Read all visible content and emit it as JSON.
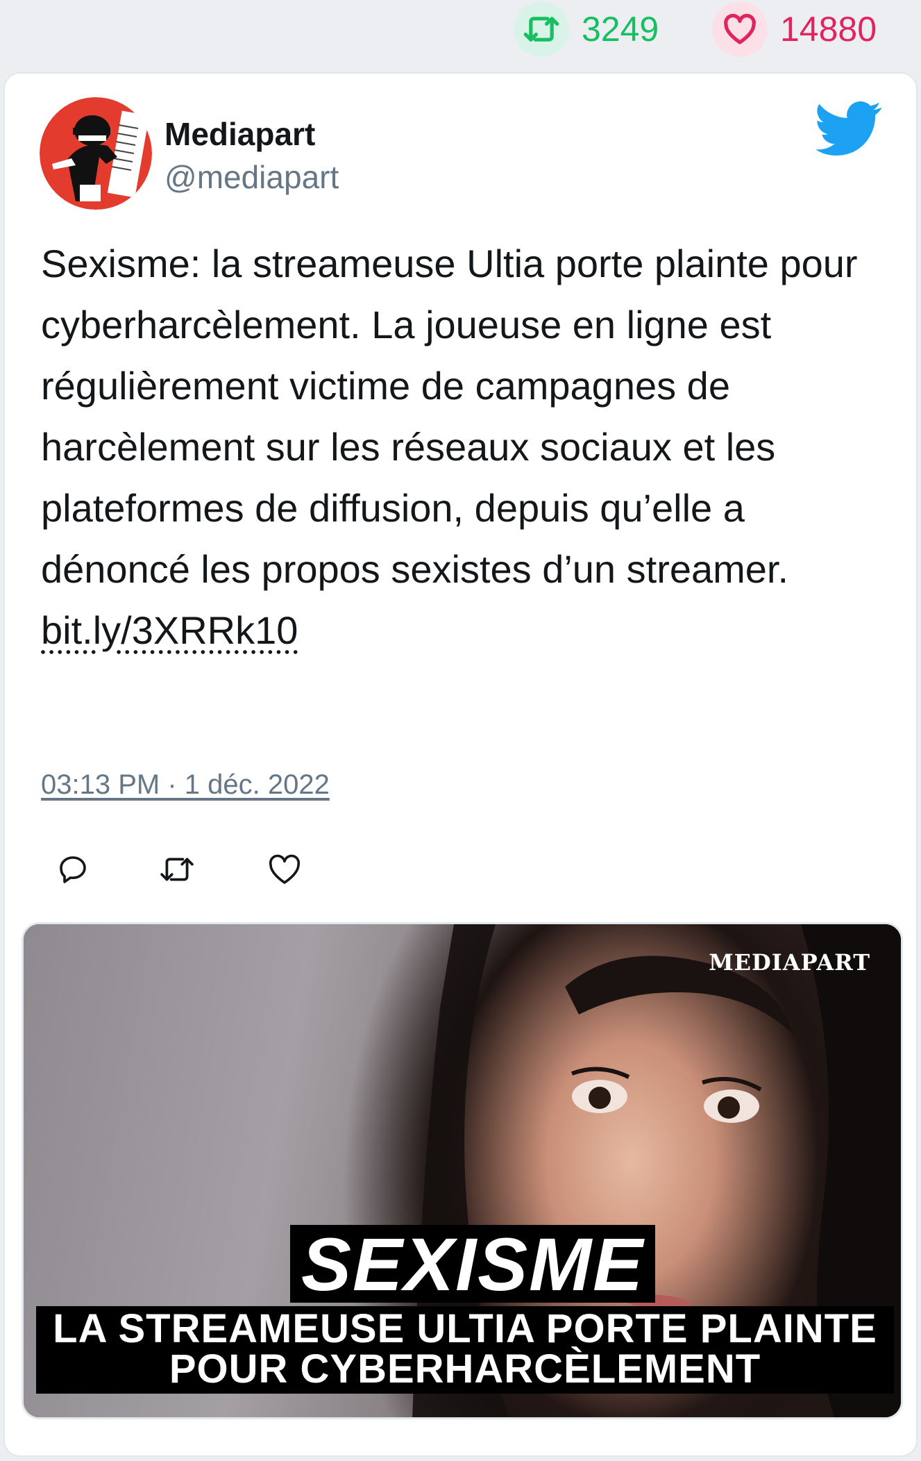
{
  "stats": {
    "retweets": "3249",
    "likes": "14880",
    "retweet_icon": "retweet-icon",
    "like_icon": "heart-icon"
  },
  "tweet": {
    "author_name": "Mediapart",
    "author_handle": "@mediapart",
    "text": "Sexisme: la streameuse Ultia porte plainte pour cyberharcèlement. La joueuse en ligne est régulièrement victime de campagnes de harcèlement sur les réseaux sociaux et les plateformes de diffusion, depuis qu’elle a dénoncé les propos sexistes d’un streamer. ",
    "link": "bit.ly/3XRRk10",
    "timestamp": "03:13 PM · 1 déc. 2022"
  },
  "media": {
    "logo": "MEDIAPART",
    "headline": "SEXISME",
    "subline_1": "LA STREAMEUSE ULTIA PORTE PLAINTE",
    "subline_2": "POUR CYBERHARCÈLEMENT"
  },
  "colors": {
    "retweet_green": "#17bf63",
    "like_red": "#e0245e",
    "twitter_blue": "#1da1f2",
    "muted_text": "#657786"
  }
}
